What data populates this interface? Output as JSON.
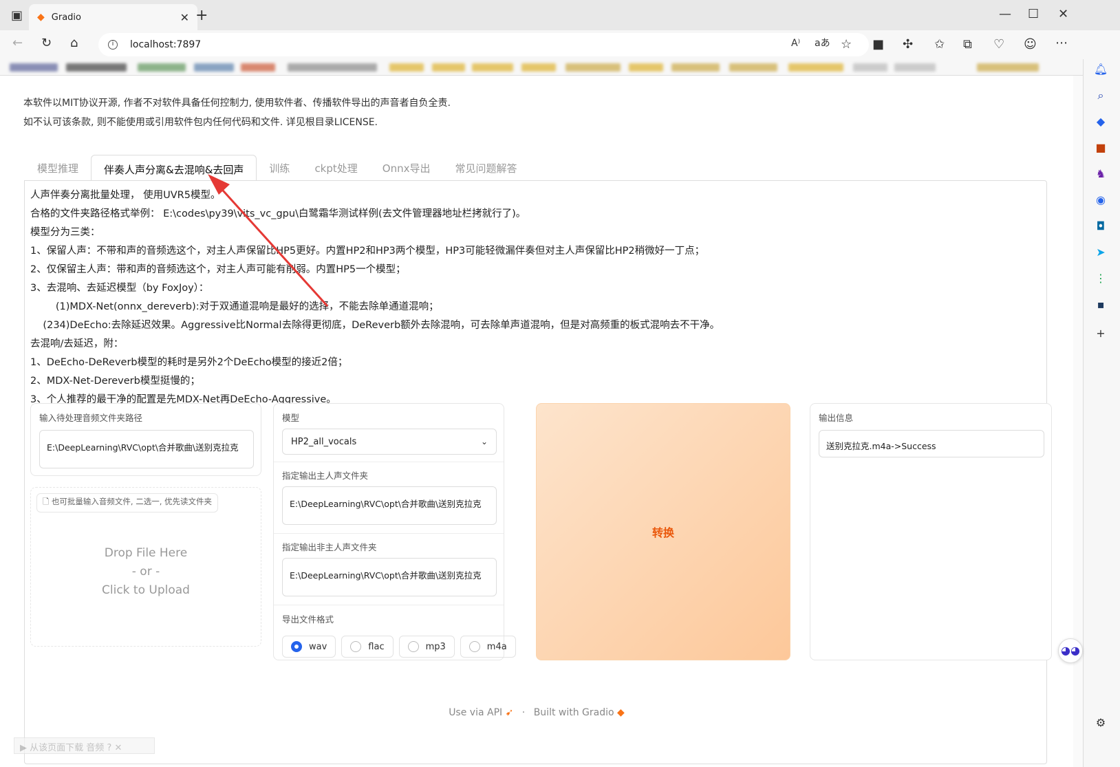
{
  "browser": {
    "tab_title": "Gradio",
    "url": "localhost:7897"
  },
  "disclaimer": {
    "line1": "本软件以MIT协议开源, 作者不对软件具备任何控制力, 使用软件者、传播软件导出的声音者自负全责.",
    "line2": "如不认可该条款, 则不能使用或引用软件包内任何代码和文件. 详见根目录LICENSE."
  },
  "tabs": [
    "模型推理",
    "伴奏人声分离&去混响&去回声",
    "训练",
    "ckpt处理",
    "Onnx导出",
    "常见问题解答"
  ],
  "active_tab": 1,
  "markdown": [
    "人声伴奏分离批量处理， 使用UVR5模型。",
    "合格的文件夹路径格式举例： E:\\codes\\py39\\vits_vc_gpu\\白鹭霜华测试样例(去文件管理器地址栏拷就行了)。",
    "模型分为三类：",
    "1、保留人声：不带和声的音频选这个，对主人声保留比HP5更好。内置HP2和HP3两个模型，HP3可能轻微漏伴奏但对主人声保留比HP2稍微好一丁点；",
    "2、仅保留主人声：带和声的音频选这个，对主人声可能有削弱。内置HP5一个模型；",
    "3、去混响、去延迟模型（by FoxJoy）：",
    "        (1)MDX-Net(onnx_dereverb):对于双通道混响是最好的选择，不能去除单通道混响；",
    "    (234)DeEcho:去除延迟效果。Aggressive比Normal去除得更彻底，DeReverb额外去除混响，可去除单声道混响，但是对高频重的板式混响去不干净。",
    "去混响/去延迟，附：",
    "1、DeEcho-DeReverb模型的耗时是另外2个DeEcho模型的接近2倍；",
    "2、MDX-Net-Dereverb模型挺慢的；",
    "3、个人推荐的最干净的配置是先MDX-Net再DeEcho-Aggressive。"
  ],
  "input_folder": {
    "label": "输入待处理音频文件夹路径",
    "value": "E:\\DeepLearning\\RVC\\opt\\合并歌曲\\送别克拉克"
  },
  "file_upload": {
    "label": "也可批量输入音频文件, 二选一, 优先读文件夹",
    "drop": "Drop File Here",
    "or": "- or -",
    "click": "Click to Upload"
  },
  "model": {
    "label": "模型",
    "value": "HP2_all_vocals"
  },
  "out_vocal": {
    "label": "指定输出主人声文件夹",
    "value": "E:\\DeepLearning\\RVC\\opt\\合并歌曲\\送别克拉克"
  },
  "out_inst": {
    "label": "指定输出非主人声文件夹",
    "value": "E:\\DeepLearning\\RVC\\opt\\合并歌曲\\送别克拉克"
  },
  "format": {
    "label": "导出文件格式",
    "options": [
      "wav",
      "flac",
      "mp3",
      "m4a"
    ],
    "selected": "wav"
  },
  "convert_button": "转换",
  "output_info": {
    "label": "输出信息",
    "value": "送别克拉克.m4a->Success"
  },
  "footer": {
    "api": "Use via API",
    "sep": "·",
    "built": "Built with Gradio"
  },
  "download_bar": "从该页面下载 音频",
  "colors": {
    "accent": "#ea580c",
    "radio_selected": "#2563eb",
    "arrow": "#e53935"
  }
}
